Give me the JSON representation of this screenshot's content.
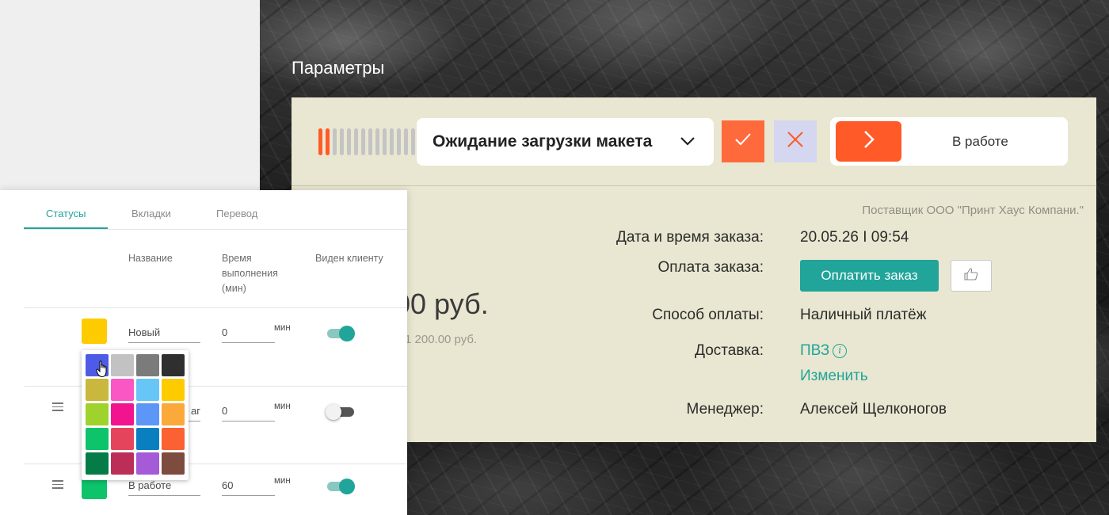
{
  "order_params": {
    "section_title": "Параметры",
    "progress": {
      "total": 14,
      "active": 2
    },
    "current_status": "Ожидание загрузки макета",
    "next_status_label": "В работе",
    "supplier": "Поставщик ООО \"Принт Хаус Компани.\"",
    "price_main": ".00 руб.",
    "price_sub": "1 200.00 руб.",
    "order_datetime_label": "Дата и время заказа:",
    "order_datetime_value": "20.05.26 I 09:54",
    "payment_label": "Оплата заказа:",
    "pay_button": "Оплатить заказ",
    "payment_method_label": "Способ оплаты:",
    "payment_method_value": "Наличный платёж",
    "delivery_label": "Доставка:",
    "delivery_value": "ПВЗ",
    "delivery_change": "Изменить",
    "manager_label": "Менеджер:",
    "manager_value": "Алексей Щелконогов",
    "colors": {
      "accent": "#ff5a27",
      "teal": "#21a49a",
      "card_bg": "#e9e7d1"
    }
  },
  "status_settings": {
    "tabs": [
      "Статусы",
      "Вкладки",
      "Перевод"
    ],
    "active_tab": "Статусы",
    "columns": {
      "name": "Название",
      "time": [
        "Время",
        "выполнения",
        "(мин)"
      ],
      "visible": "Виден клиенту"
    },
    "rows": [
      {
        "name": "Новый",
        "time": "0",
        "unit": "мин",
        "visible": true,
        "color": "#fecb00"
      },
      {
        "name": "аг",
        "time": "0",
        "unit": "мин",
        "visible": false,
        "color": "#e84a1a"
      },
      {
        "name": "В работе",
        "time": "60",
        "unit": "мин",
        "visible": true,
        "color": "#0dc46b"
      }
    ]
  },
  "color_picker": {
    "colors": [
      "#4d5be6",
      "#c2c2c2",
      "#7b7b7b",
      "#2f2f2f",
      "#c9b83d",
      "#fb57c4",
      "#67c6f5",
      "#fecb00",
      "#9fd22d",
      "#f2138e",
      "#5c96f7",
      "#fba93b",
      "#0dc46b",
      "#e5455c",
      "#0a7fc0",
      "#fb6132",
      "#057c47",
      "#bc2e58",
      "#a55ad7",
      "#7d4c3e"
    ],
    "selected_index": 0
  }
}
